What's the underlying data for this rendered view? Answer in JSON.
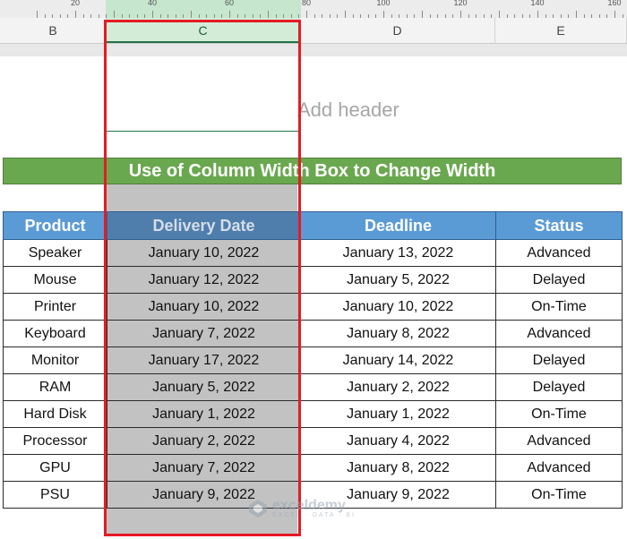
{
  "ruler": {
    "labels": [
      "20",
      "40",
      "60",
      "80",
      "100",
      "120",
      "140",
      "160"
    ]
  },
  "columns": [
    "B",
    "C",
    "D",
    "E"
  ],
  "page": {
    "add_header": "Add header"
  },
  "title": "Use of Column Width Box to Change Width",
  "table": {
    "headers": [
      "Product",
      "Delivery  Date",
      "Deadline",
      "Status"
    ],
    "rows": [
      [
        "Speaker",
        "January 10, 2022",
        "January 13, 2022",
        "Advanced"
      ],
      [
        "Mouse",
        "January 12, 2022",
        "January 5, 2022",
        "Delayed"
      ],
      [
        "Printer",
        "January 10, 2022",
        "January 10, 2022",
        "On-Time"
      ],
      [
        "Keyboard",
        "January 7, 2022",
        "January 8, 2022",
        "Advanced"
      ],
      [
        "Monitor",
        "January 17, 2022",
        "January 14, 2022",
        "Delayed"
      ],
      [
        "RAM",
        "January 5, 2022",
        "January 2, 2022",
        "Delayed"
      ],
      [
        "Hard Disk",
        "January 1, 2022",
        "January 1, 2022",
        "On-Time"
      ],
      [
        "Processor",
        "January 2, 2022",
        "January 4, 2022",
        "Advanced"
      ],
      [
        "GPU",
        "January 7, 2022",
        "January 8, 2022",
        "Advanced"
      ],
      [
        "PSU",
        "January 9, 2022",
        "January 9, 2022",
        "On-Time"
      ]
    ]
  },
  "colors": {
    "title_bg": "#6aa84f",
    "header_bg": "#5b9bd5",
    "selection_border": "#e51b24",
    "selected_shade": "#c2c2c2"
  },
  "watermark": {
    "name": "exceldemy",
    "tagline": "EXCEL · DATA · BI",
    "icon": "exceldemy-logo-icon"
  }
}
